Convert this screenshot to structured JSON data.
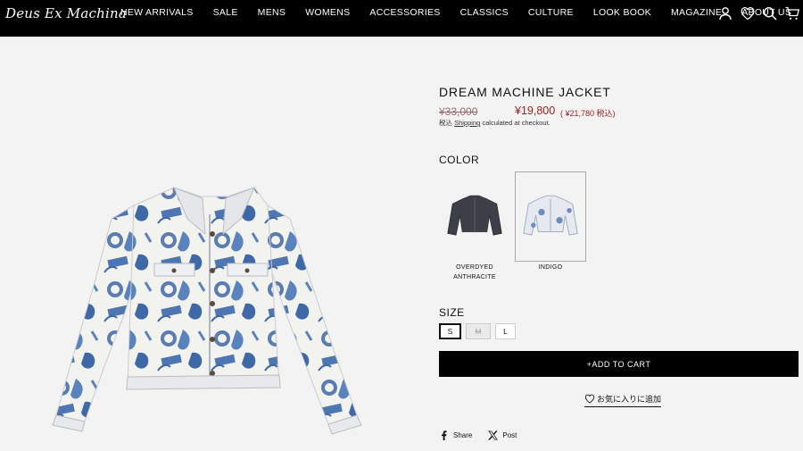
{
  "header": {
    "logo": "Deus Ex Machina",
    "nav": [
      "NEW ARRIVALS",
      "SALE",
      "MENS",
      "WOMENS",
      "ACCESSORIES",
      "CLASSICS",
      "CULTURE",
      "LOOK BOOK",
      "MAGAZINE",
      "ABOUT US"
    ],
    "icons": [
      "account-icon",
      "wishlist-heart-icon",
      "search-icon",
      "cart-icon"
    ]
  },
  "product": {
    "title": "DREAM MACHINE JACKET",
    "price_old": "¥33,000",
    "price_new": "¥19,800",
    "price_tax": "( ¥21,780 税込)",
    "tax_prefix": "税込 ",
    "shipping_link": "Shipping",
    "shipping_suffix": " calculated at checkout.",
    "color_label": "COLOR",
    "colors": [
      {
        "line1": "OVERDYED",
        "line2": "ANTHRACITE",
        "swatch": "#3d4048"
      },
      {
        "line1": "INDIGO",
        "line2": "",
        "swatch": "#e6e9ef"
      }
    ],
    "selected_color": "INDIGO",
    "size_label": "SIZE",
    "sizes": [
      "S",
      "M",
      "L"
    ],
    "selected_size": "S",
    "unavailable_size": "M",
    "add_to_cart": "+ADD TO CART",
    "wishlist": "お気に入りに追加",
    "share": "Share",
    "post": "Post"
  },
  "colors": {
    "header_bg": "#000000",
    "page_bg": "#f3f3f3",
    "sale_red": "#9b1d1d",
    "jacket_blue": "#3f68a6",
    "jacket_base": "#f2f2ee"
  }
}
